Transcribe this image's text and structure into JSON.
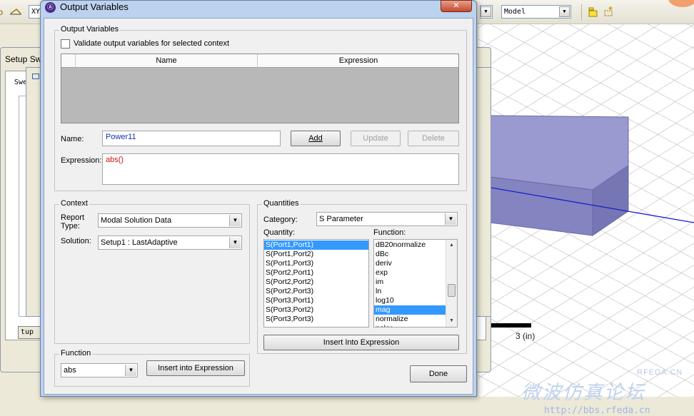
{
  "background": {
    "toolbar_field_left": "XY",
    "toolbar_model_combo": "Model",
    "setup_window_title": "Setup Sw",
    "setup_tab_label": "Swe",
    "setup_button_label": "tup C",
    "scale_label": "3 (in)",
    "watermark_logo": "RFEDA.CN",
    "watermark_chinese": "微波仿真论坛",
    "watermark_url": "http://bbs.rfeda.cn"
  },
  "dialog": {
    "title": "Output Variables",
    "output_group": {
      "title": "Output Variables",
      "validate_label": "Validate output variables for selected context",
      "validate_checked": false,
      "table_headers": [
        "Name",
        "Expression"
      ],
      "name_label": "Name:",
      "name_value": "Power11",
      "add_label": "Add",
      "update_label": "Update",
      "delete_label": "Delete",
      "expression_label": "Expression:",
      "expression_value": "abs()"
    },
    "context_group": {
      "title": "Context",
      "report_type_label": "Report Type:",
      "report_type_value": "Modal Solution Data",
      "solution_label": "Solution:",
      "solution_value": "Setup1 : LastAdaptive"
    },
    "quantities_group": {
      "title": "Quantities",
      "category_label": "Category:",
      "category_value": "S Parameter",
      "quantity_label": "Quantity:",
      "quantities": [
        "S(Port1,Port1)",
        "S(Port1,Port2)",
        "S(Port1,Port3)",
        "S(Port2,Port1)",
        "S(Port2,Port2)",
        "S(Port2,Port3)",
        "S(Port3,Port1)",
        "S(Port3,Port2)",
        "S(Port3,Port3)"
      ],
      "quantity_selected": "S(Port1,Port1)",
      "function_label": "Function:",
      "functions": [
        "dB20normalize",
        "dBc",
        "deriv",
        "exp",
        "im",
        "ln",
        "log10",
        "mag",
        "normalize",
        "polar"
      ],
      "function_selected": "mag",
      "insert_label": "Insert Into Expression"
    },
    "function_group": {
      "title": "Function",
      "function_value": "abs",
      "insert_label": "Insert into Expression"
    },
    "done_label": "Done"
  },
  "colors": {
    "selection": "#3399ff",
    "name_text": "#1a2fb0",
    "expression_text": "#d01010",
    "box_fill": "#8c8cc6"
  }
}
